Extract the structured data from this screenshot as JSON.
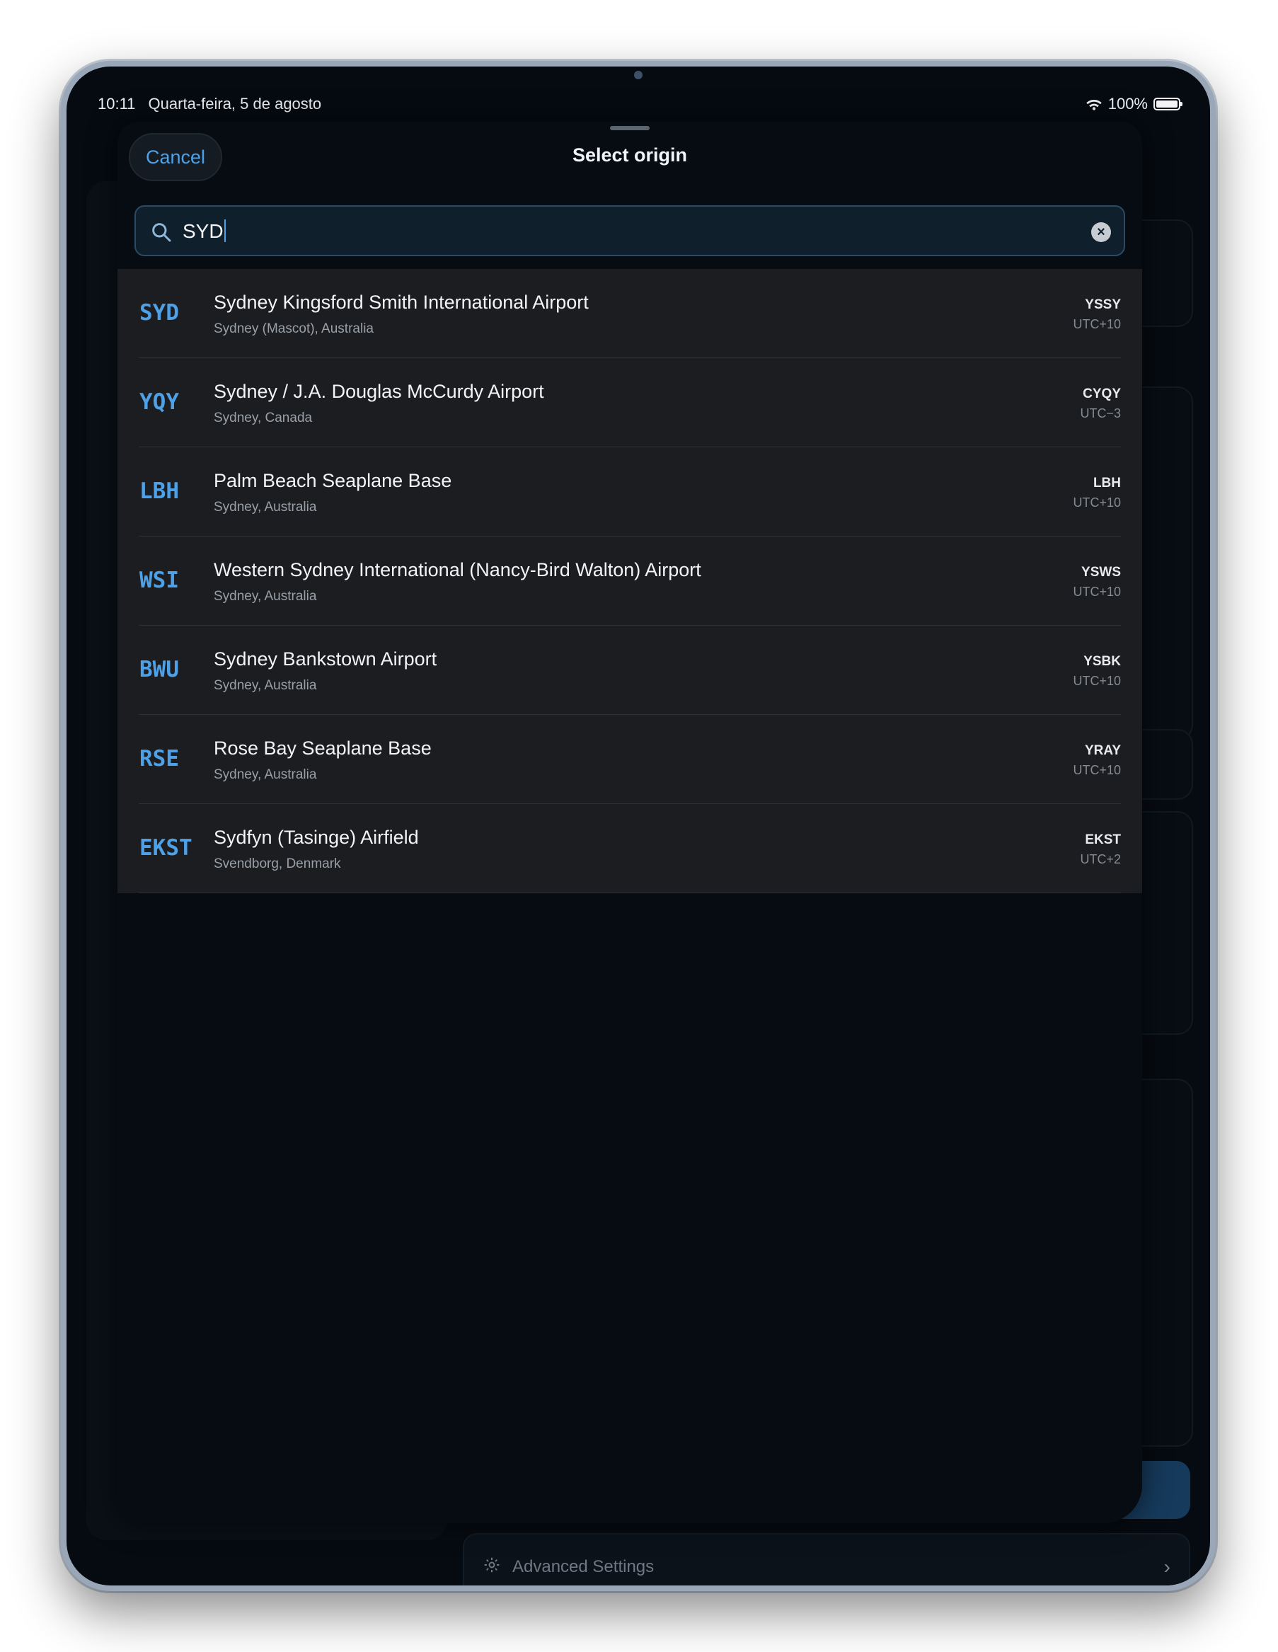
{
  "status_bar": {
    "time": "10:11",
    "date": "Quarta-feira, 5 de agosto",
    "battery": "100%"
  },
  "sheet": {
    "cancel_label": "Cancel",
    "title": "Select origin"
  },
  "search": {
    "value": "SYD",
    "clear_icon": "clear-circle-icon"
  },
  "results": [
    {
      "code": "SYD",
      "name": "Sydney Kingsford Smith International Airport",
      "location": "Sydney (Mascot), Australia",
      "icao": "YSSY",
      "utc": "UTC+10"
    },
    {
      "code": "YQY",
      "name": "Sydney / J.A. Douglas McCurdy Airport",
      "location": "Sydney, Canada",
      "icao": "CYQY",
      "utc": "UTC−3"
    },
    {
      "code": "LBH",
      "name": "Palm Beach Seaplane Base",
      "location": "Sydney, Australia",
      "icao": "LBH",
      "utc": "UTC+10"
    },
    {
      "code": "WSI",
      "name": "Western Sydney International (Nancy-Bird Walton) Airport",
      "location": "Sydney, Australia",
      "icao": "YSWS",
      "utc": "UTC+10"
    },
    {
      "code": "BWU",
      "name": "Sydney Bankstown Airport",
      "location": "Sydney, Australia",
      "icao": "YSBK",
      "utc": "UTC+10"
    },
    {
      "code": "RSE",
      "name": "Rose Bay Seaplane Base",
      "location": "Sydney, Australia",
      "icao": "YRAY",
      "utc": "UTC+10"
    },
    {
      "code": "EKST",
      "name": "Sydfyn (Tasinge) Airfield",
      "location": "Svendborg, Denmark",
      "icao": "EKST",
      "utc": "UTC+2"
    }
  ],
  "background": {
    "advanced_settings_label": "Advanced Settings"
  },
  "colors": {
    "accent": "#4ea1e6",
    "sheet_bg": "#070c12",
    "row_bg": "#1c1d20"
  }
}
